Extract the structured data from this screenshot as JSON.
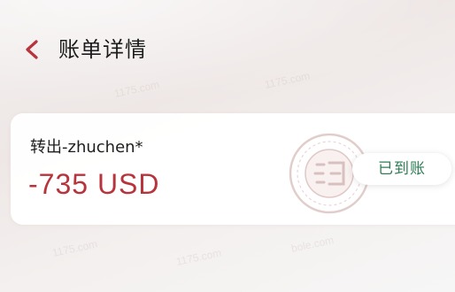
{
  "header": {
    "back_icon": "chevron-left-icon",
    "title": "账单详情"
  },
  "transaction": {
    "label": "转出-zhuchen*",
    "amount": "-735 USD",
    "status": "已到账",
    "stamp_icon": "seal-stamp-icon"
  },
  "colors": {
    "accent": "#b8343c",
    "status_green": "#2d7d56",
    "title_text": "#1b1b1b"
  }
}
